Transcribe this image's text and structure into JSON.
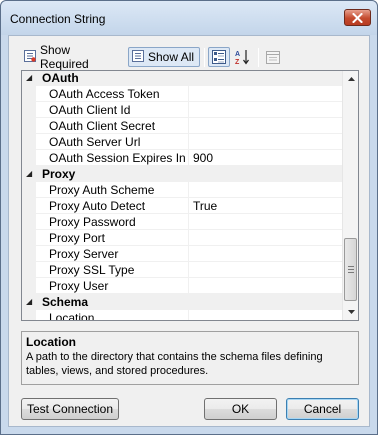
{
  "window": {
    "title": "Connection String"
  },
  "toolbar": {
    "show_required_label": "Show Required",
    "show_all_label": "Show All",
    "categorized_icon": "categorized-icon",
    "alphabetical_icon": "sort-az-icon",
    "property_pages_icon": "property-pages-icon"
  },
  "grid": {
    "rows": [
      {
        "type": "category",
        "label": "OAuth"
      },
      {
        "type": "property",
        "name": "OAuth Access Token",
        "value": ""
      },
      {
        "type": "property",
        "name": "OAuth Client Id",
        "value": ""
      },
      {
        "type": "property",
        "name": "OAuth Client Secret",
        "value": ""
      },
      {
        "type": "property",
        "name": "OAuth Server Url",
        "value": ""
      },
      {
        "type": "property",
        "name": "OAuth Session Expires In",
        "value": "900"
      },
      {
        "type": "category",
        "label": "Proxy"
      },
      {
        "type": "property",
        "name": "Proxy Auth Scheme",
        "value": ""
      },
      {
        "type": "property",
        "name": "Proxy Auto Detect",
        "value": "True"
      },
      {
        "type": "property",
        "name": "Proxy Password",
        "value": ""
      },
      {
        "type": "property",
        "name": "Proxy Port",
        "value": ""
      },
      {
        "type": "property",
        "name": "Proxy Server",
        "value": ""
      },
      {
        "type": "property",
        "name": "Proxy SSL Type",
        "value": ""
      },
      {
        "type": "property",
        "name": "Proxy User",
        "value": ""
      },
      {
        "type": "category",
        "label": "Schema"
      },
      {
        "type": "property",
        "name": "Location",
        "value": "",
        "selected": true
      }
    ]
  },
  "help": {
    "title": "Location",
    "description": "A path to the directory that contains the schema files defining tables, views, and stored procedures."
  },
  "buttons": {
    "test_connection": "Test Connection",
    "ok": "OK",
    "cancel": "Cancel"
  },
  "colors": {
    "close_button": "#c44a2e",
    "titlebar": "#c9d9ec"
  }
}
